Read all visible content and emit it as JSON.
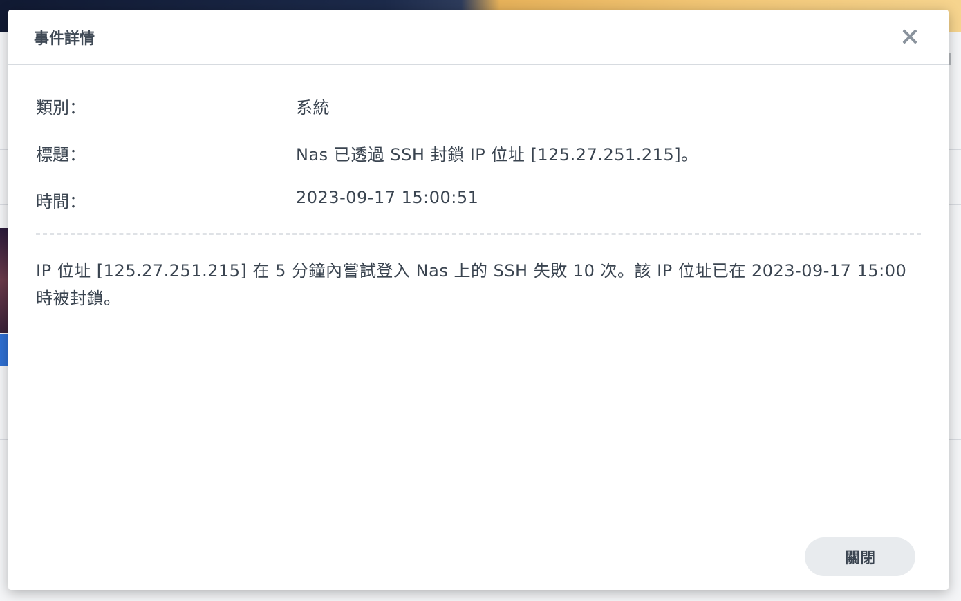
{
  "dialog": {
    "title": "事件詳情",
    "close_icon": "close-icon"
  },
  "details": {
    "category": {
      "label": "類別：",
      "value": "系統"
    },
    "title": {
      "label": "標題：",
      "value": "Nas 已透過 SSH 封鎖 IP 位址 [125.27.251.215]。"
    },
    "time": {
      "label": "時間：",
      "value": "2023-09-17 15:00:51"
    }
  },
  "description": "IP 位址 [125.27.251.215] 在 5 分鐘內嘗試登入 Nas 上的 SSH 失敗 10 次。該 IP 位址已在 2023-09-17 15:00 時被封鎖。",
  "footer": {
    "close_button_label": "關閉"
  },
  "colors": {
    "text": "#3a4450",
    "title": "#404a56",
    "button_bg": "#e8ebee",
    "divider": "#d7dbe0"
  }
}
